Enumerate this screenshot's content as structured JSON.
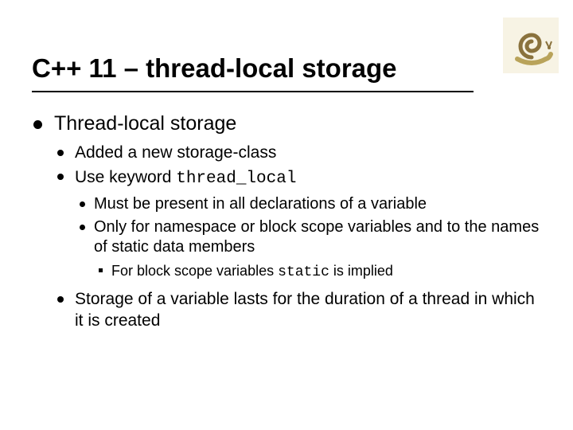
{
  "title": "C++ 11 – thread-local storage",
  "body": {
    "heading": "Thread-local storage",
    "items": [
      {
        "text": "Added a new storage-class"
      },
      {
        "prefix": "Use keyword ",
        "code": "thread_local",
        "sub": [
          {
            "text": "Must be present in all declarations of a variable"
          },
          {
            "text": "Only for namespace or block scope variables and to the names of static data members",
            "sub": [
              {
                "prefix": "For block scope variables ",
                "code": "static",
                "suffix": " is implied"
              }
            ]
          }
        ]
      },
      {
        "text": "Storage of a variable lasts for the duration of a thread in which it is created"
      }
    ]
  }
}
